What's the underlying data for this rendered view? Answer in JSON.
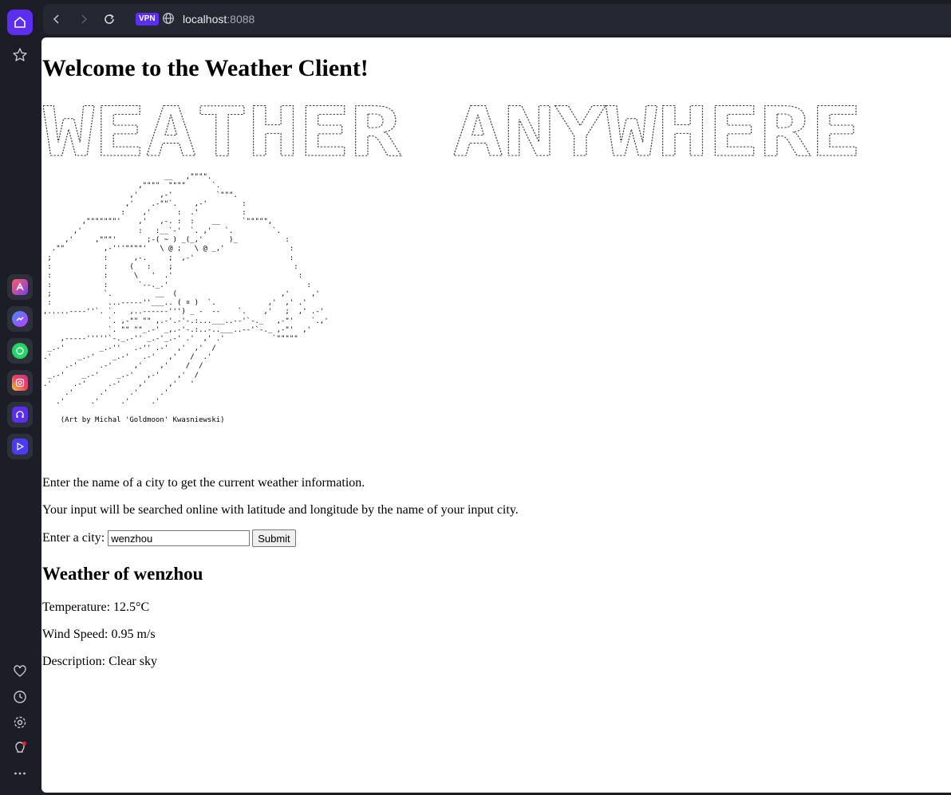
{
  "browser": {
    "vpn_label": "VPN",
    "url_host": "localhost",
    "url_port": ":8088",
    "accent_color": "#5b2ef0"
  },
  "sidebar": {
    "icons": [
      "home-icon",
      "star-icon",
      "aria-icon",
      "messenger-icon",
      "whatsapp-icon",
      "instagram-icon",
      "music-player-icon",
      "video-player-icon",
      "heart-icon",
      "history-icon",
      "settings-icon",
      "lightbulb-icon",
      "more-icon"
    ]
  },
  "page": {
    "title": "Welcome to the Weather Client!",
    "banner_text": "WEATHER ANYWHERE",
    "art_credit": "(Art by Michal 'Goldmoon' Kwasniewski)",
    "intro_1": "Enter the name of a city to get the current weather information.",
    "intro_2": "Your input will be searched online with latitude and longitude by the name of your input city.",
    "form": {
      "label": "Enter a city:",
      "value": "wenzhou",
      "submit": "Submit"
    },
    "result": {
      "heading": "Weather of wenzhou",
      "temperature": "Temperature: 12.5°C",
      "wind_speed": "Wind Speed: 0.95 m/s",
      "description": "Description: Clear sky"
    }
  }
}
